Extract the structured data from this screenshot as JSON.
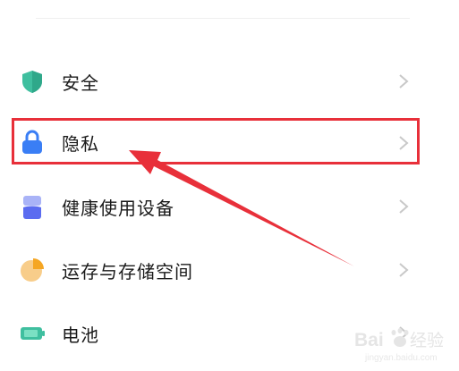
{
  "settings": {
    "items": [
      {
        "label": "安全",
        "icon": "shield-icon",
        "color": "#3fbf9f"
      },
      {
        "label": "隐私",
        "icon": "lock-icon",
        "color": "#3a7ef5"
      },
      {
        "label": "健康使用设备",
        "icon": "hourglass-icon",
        "color": "#5b6cf0"
      },
      {
        "label": "运存与存储空间",
        "icon": "storage-pie-icon",
        "color": "#f5a623"
      },
      {
        "label": "电池",
        "icon": "battery-icon",
        "color": "#3fbf9f"
      }
    ]
  },
  "annotation": {
    "highlight_color": "#e8303a",
    "highlighted_item": "隐私"
  },
  "watermark": {
    "text": "Bai经验",
    "subtext": "jingyan.baidu.com"
  }
}
